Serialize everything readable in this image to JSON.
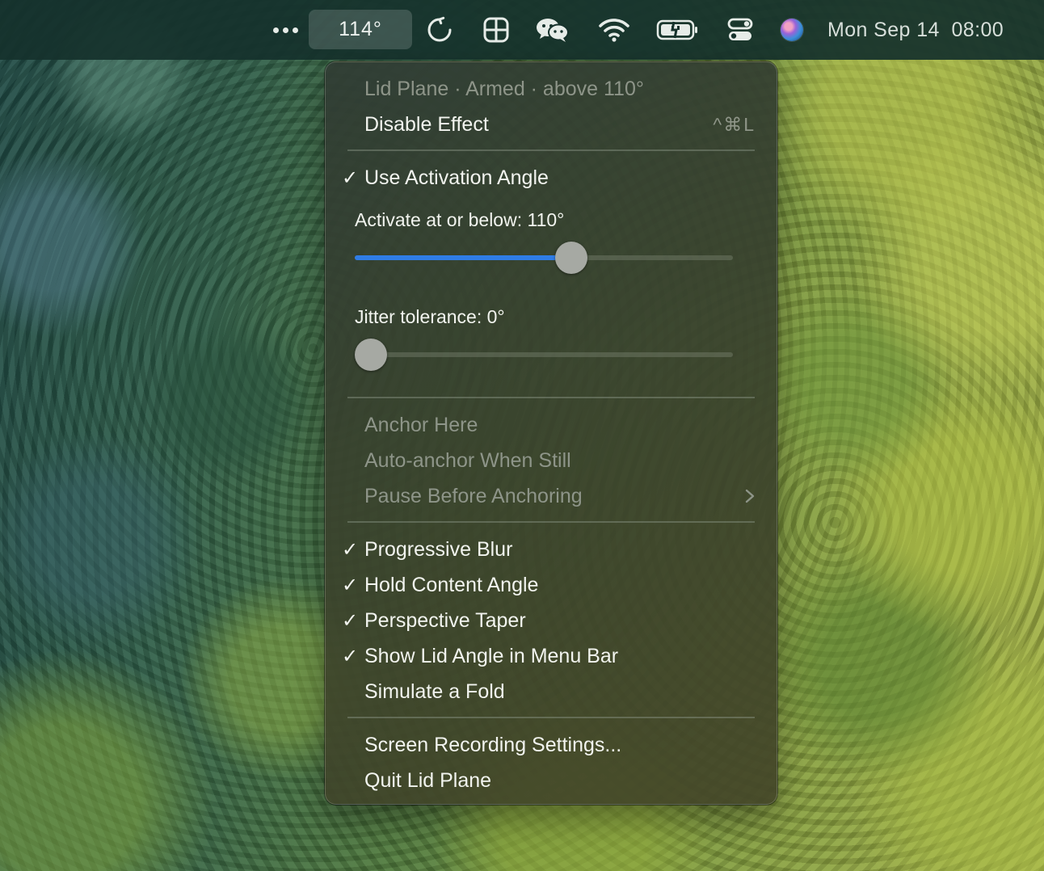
{
  "menubar": {
    "lid_angle": "114°",
    "clock": "Mon Sep 14  08:00",
    "icons": [
      "more-icon",
      "reload-icon",
      "grid-icon",
      "wechat-icon",
      "wifi-icon",
      "battery-charging-icon",
      "control-center-icon",
      "siri-icon"
    ]
  },
  "menu": {
    "status": "Lid Plane · Armed · above 110°",
    "disable_effect": "Disable Effect",
    "disable_shortcut": "^⌘L",
    "use_activation_angle": "Use Activation Angle",
    "activation_slider": {
      "label": "Activate at or below: 110°",
      "value": 110,
      "fill_fraction": 0.58
    },
    "jitter_slider": {
      "label": "Jitter tolerance: 0°",
      "value": 0,
      "fill_fraction": 0
    },
    "anchor_here": "Anchor Here",
    "auto_anchor": "Auto-anchor When Still",
    "pause_before_anchoring": "Pause Before Anchoring",
    "progressive_blur": "Progressive Blur",
    "hold_content_angle": "Hold Content Angle",
    "perspective_taper": "Perspective Taper",
    "show_lid_angle": "Show Lid Angle in Menu Bar",
    "simulate_fold": "Simulate a Fold",
    "screen_recording_settings": "Screen Recording Settings...",
    "quit": "Quit Lid Plane",
    "checkmark": "✓"
  },
  "colors": {
    "accent": "#2f7de6",
    "menubar_bg": "#16322c",
    "menu_text": "#f2f4ef",
    "menu_dim_text": "#8e9589"
  }
}
